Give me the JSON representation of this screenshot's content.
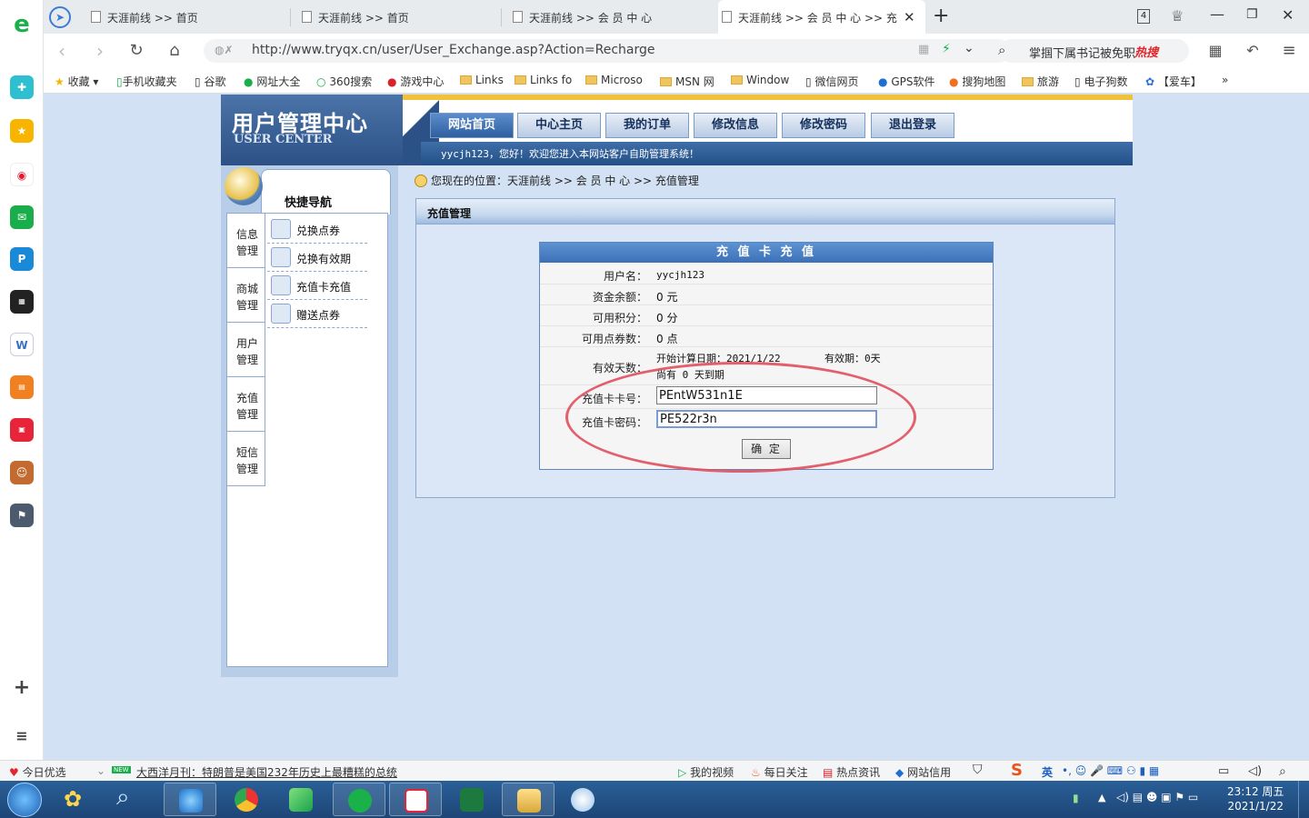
{
  "browser": {
    "tabs": [
      {
        "title": "天涯前线 >> 首页"
      },
      {
        "title": "天涯前线 >> 首页"
      },
      {
        "title": "天涯前线 >> 会 员 中 心"
      },
      {
        "title": "天涯前线 >> 会 员 中 心 >> 充"
      }
    ],
    "tab_count": "4",
    "url": "http://www.tryqx.cn/user/User_Exchange.asp?Action=Recharge",
    "search_text": "掌掴下属书记被免职",
    "search_badge": "热搜",
    "bookmarks": [
      "收藏",
      "手机收藏夹",
      "谷歌",
      "网址大全",
      "360搜索",
      "游戏中心",
      "Links",
      "Links fo",
      "Microso",
      "MSN 网",
      "Window",
      "微信网页",
      "GPS软件",
      "搜狗地图",
      "旅游",
      "电子狗数",
      "【爱车】"
    ],
    "bookmark_more": "»"
  },
  "user_center": {
    "logo_cn": "用户管理中心",
    "logo_en": "USER CENTER",
    "menu": [
      "网站首页",
      "中心主页",
      "我的订单",
      "修改信息",
      "修改密码",
      "退出登录"
    ],
    "welcome": "yycjh123，您好！欢迎您进入本网站客户自助管理系统！",
    "sidebar_title": "快捷导航",
    "categories": [
      [
        "信息",
        "管理"
      ],
      [
        "商城",
        "管理"
      ],
      [
        "用户",
        "管理"
      ],
      [
        "充值",
        "管理"
      ],
      [
        "短信",
        "管理"
      ]
    ],
    "items": [
      "兑换点券",
      "兑换有效期",
      "充值卡充值",
      "赠送点券"
    ],
    "breadcrumb": "您现在的位置：天涯前线 >> 会 员 中 心 >> 充值管理",
    "panel_title": "充值管理",
    "form": {
      "title": "充 值 卡 充 值",
      "username_label": "用户名：",
      "username": "yycjh123",
      "balance_label": "资金余额：",
      "balance": "0 元",
      "points_label": "可用积分：",
      "points": "0 分",
      "coupons_label": "可用点券数：",
      "coupons": "0 点",
      "valid_label": "有效天数：",
      "valid_start": "开始计算日期：2021/1/22",
      "valid_period": "有效期：0天",
      "valid_remain": "尚有 0 天到期",
      "card_no_label": "充值卡卡号：",
      "card_no": "PEntW531n1E",
      "card_pwd_label": "充值卡密码：",
      "card_pwd": "PE522r3n",
      "submit": "确 定"
    }
  },
  "statusbar": {
    "left": "今日优选",
    "news_badge": "NEW",
    "news": "大西洋月刊：特朗普是美国232年历史上最糟糕的总统",
    "items": [
      "我的视频",
      "每日关注",
      "热点资讯",
      "网站信用"
    ],
    "ime": "英"
  },
  "taskbar": {
    "time": "23:12 周五",
    "date": "2021/1/22"
  },
  "colors": {
    "accent": "#2f5f9f",
    "page_bg": "#d2e1f3",
    "circle": "#e0505e"
  }
}
